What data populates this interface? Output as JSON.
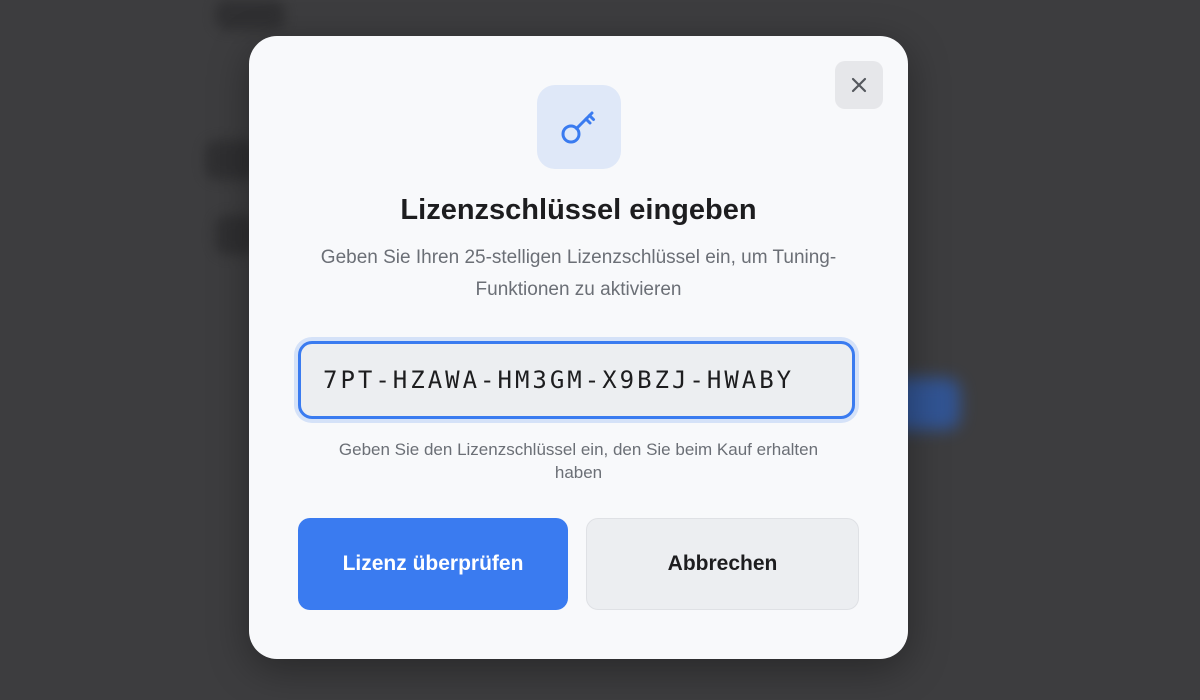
{
  "dialog": {
    "title": "Lizenzschlüssel eingeben",
    "subtitle": "Geben Sie Ihren 25-stelligen Lizenzschlüssel ein, um Tuning-Funktionen zu aktivieren",
    "license_input": {
      "value": "7PT-HZAWA-HM3GM-X9BZJ-HWABY"
    },
    "hint": "Geben Sie den Lizenzschlüssel ein, den Sie beim Kauf erhalten haben",
    "verify_label": "Lizenz überprüfen",
    "cancel_label": "Abbrechen"
  },
  "icons": {
    "header": "key-icon",
    "close": "close-icon"
  },
  "colors": {
    "accent": "#3a7bf0",
    "modal_bg": "#f8f9fb",
    "backdrop": "#3d3d3f"
  }
}
